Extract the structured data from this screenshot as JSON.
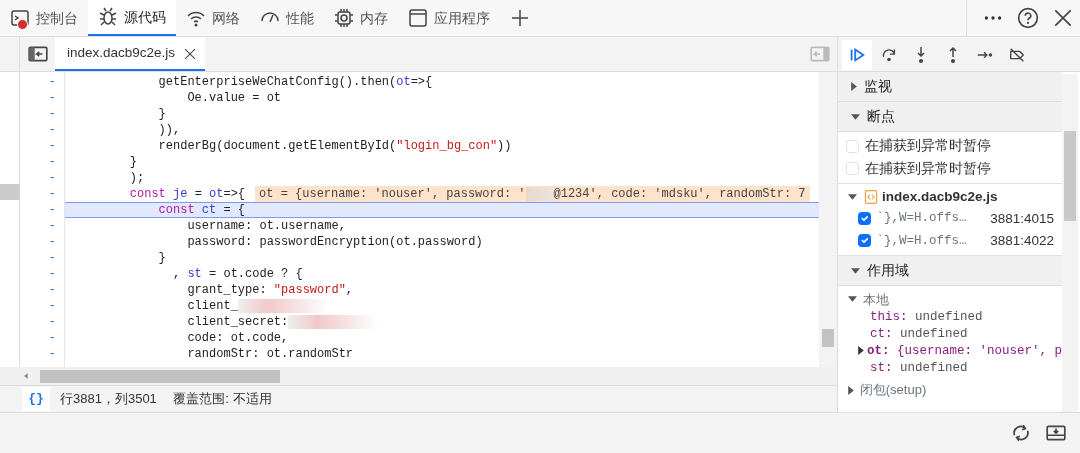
{
  "main_tabs": [
    {
      "label": "控制台",
      "selected": false,
      "error_badge": true
    },
    {
      "label": "源代码",
      "selected": true,
      "error_badge": false
    },
    {
      "label": "网络",
      "selected": false,
      "error_badge": false
    },
    {
      "label": "性能",
      "selected": false,
      "error_badge": false
    },
    {
      "label": "内存",
      "selected": false,
      "error_badge": false
    },
    {
      "label": "应用程序",
      "selected": false,
      "error_badge": false
    }
  ],
  "file_tabs": [
    {
      "label": "index.dacb9c2e.js",
      "selected": true
    }
  ],
  "debug_tools": [
    {
      "kind": "resume",
      "selected": true
    },
    {
      "kind": "step-over",
      "selected": false
    },
    {
      "kind": "step-into",
      "selected": false
    },
    {
      "kind": "step-out",
      "selected": false
    },
    {
      "kind": "step",
      "selected": false
    },
    {
      "kind": "deactivate",
      "selected": false
    }
  ],
  "code_lines": [
    {
      "marker": "-",
      "current": false,
      "segments": [
        {
          "text": "             getEnterpriseWeChatConfig().then(",
          "kind": "plain"
        },
        {
          "text": "ot",
          "kind": "var"
        },
        {
          "text": "=>{",
          "kind": "plain"
        }
      ]
    },
    {
      "marker": "-",
      "current": false,
      "segments": [
        {
          "text": "                 Oe.value = ot",
          "kind": "plain"
        }
      ]
    },
    {
      "marker": "-",
      "current": false,
      "segments": [
        {
          "text": "             }",
          "kind": "plain"
        }
      ]
    },
    {
      "marker": "-",
      "current": false,
      "segments": [
        {
          "text": "             )),",
          "kind": "plain"
        }
      ]
    },
    {
      "marker": "-",
      "current": false,
      "segments": [
        {
          "text": "             renderBg(document.getElementById(",
          "kind": "plain"
        },
        {
          "text": "\"login_bg_con\"",
          "kind": "string"
        },
        {
          "text": "))",
          "kind": "plain"
        }
      ]
    },
    {
      "marker": "-",
      "current": false,
      "segments": [
        {
          "text": "         }",
          "kind": "plain"
        }
      ]
    },
    {
      "marker": "-",
      "current": false,
      "segments": [
        {
          "text": "         );",
          "kind": "plain"
        }
      ]
    },
    {
      "marker": "-",
      "current": false,
      "segments": [
        {
          "text": "         const ",
          "kind": "keyword"
        },
        {
          "text": "je",
          "kind": "var"
        },
        {
          "text": " = ",
          "kind": "plain"
        },
        {
          "text": "ot",
          "kind": "var"
        },
        {
          "text": "=>{",
          "kind": "plain"
        }
      ],
      "inline_value": [
        "ot = {username: 'nouser', password: '",
        "@1234', code: 'mdsku', randomStr: 7"
      ]
    },
    {
      "marker": "-",
      "current": true,
      "segments": [
        {
          "text": "             const ",
          "kind": "keyword"
        },
        {
          "text": "ct",
          "kind": "var"
        },
        {
          "text": " = {",
          "kind": "plain"
        }
      ]
    },
    {
      "marker": "-",
      "current": false,
      "segments": [
        {
          "text": "                 username: ot.username,",
          "kind": "plain"
        }
      ]
    },
    {
      "marker": "-",
      "current": false,
      "segments": [
        {
          "text": "                 password: passwordEncryption(ot.password)",
          "kind": "plain"
        }
      ]
    },
    {
      "marker": "-",
      "current": false,
      "segments": [
        {
          "text": "             }",
          "kind": "plain"
        }
      ]
    },
    {
      "marker": "-",
      "current": false,
      "segments": [
        {
          "text": "               , ",
          "kind": "plain"
        },
        {
          "text": "st",
          "kind": "var"
        },
        {
          "text": " = ot.code ? {",
          "kind": "plain"
        }
      ]
    },
    {
      "marker": "-",
      "current": false,
      "segments": [
        {
          "text": "                 grant_type: ",
          "kind": "plain"
        },
        {
          "text": "\"password\"",
          "kind": "string"
        },
        {
          "text": ",",
          "kind": "plain"
        }
      ]
    },
    {
      "marker": "-",
      "current": false,
      "segments": [
        {
          "text": "                 client_",
          "kind": "plain"
        }
      ],
      "redacted": true
    },
    {
      "marker": "-",
      "current": false,
      "segments": [
        {
          "text": "                 client_secret:",
          "kind": "plain"
        }
      ],
      "redacted": true
    },
    {
      "marker": "-",
      "current": false,
      "segments": [
        {
          "text": "                 code: ot.code,",
          "kind": "plain"
        }
      ]
    },
    {
      "marker": "-",
      "current": false,
      "segments": [
        {
          "text": "                 randomStr: ot.randomStr",
          "kind": "plain"
        }
      ]
    }
  ],
  "status_bar": {
    "pretty_print": "{}",
    "position": "行3881，列3501",
    "coverage": "覆盖范围: 不适用"
  },
  "sidebar": {
    "sections": [
      {
        "title": "监视",
        "expanded": false
      },
      {
        "title": "断点",
        "expanded": true,
        "checkboxes": [
          {
            "label": "在捕获到异常时暂停",
            "checked": false
          },
          {
            "label": "在捕获到异常时暂停",
            "checked": false
          }
        ],
        "file": {
          "name": "index.dacb9c2e.js",
          "expanded": true
        },
        "breakpoints": [
          {
            "code": "`},W=H.offs…",
            "location": "3881:4015",
            "checked": true
          },
          {
            "code": "`},W=H.offs…",
            "location": "3881:4022",
            "checked": true
          }
        ]
      },
      {
        "title": "作用域",
        "expanded": true,
        "scopes": [
          {
            "title": "本地",
            "expanded": true,
            "vars": [
              {
                "name": "this:",
                "value": "undefined",
                "expandable": false
              },
              {
                "name": "ct:",
                "value": "undefined",
                "expandable": false
              },
              {
                "name": "ot:",
                "value": "{username: 'nouser', p",
                "expandable": true
              },
              {
                "name": "st:",
                "value": "undefined",
                "expandable": false
              }
            ]
          },
          {
            "title": "闭包(setup)",
            "expanded": false
          }
        ]
      }
    ]
  }
}
